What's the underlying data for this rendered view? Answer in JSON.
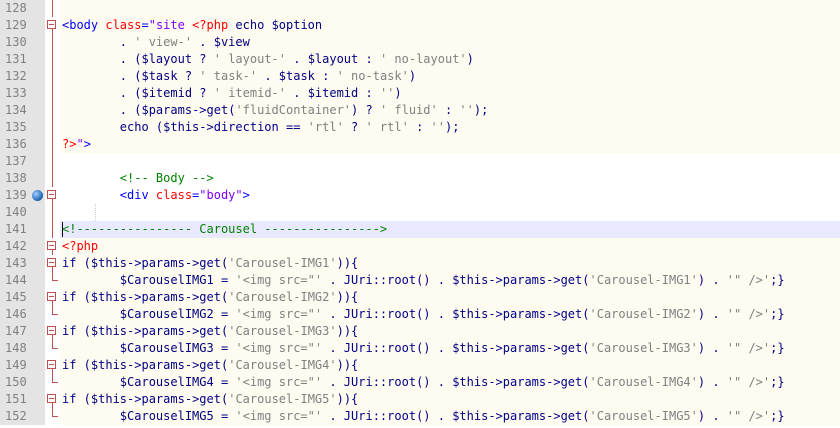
{
  "editor": {
    "lines": [
      {
        "num": "128",
        "fold": "line",
        "bg": "php",
        "tokens": []
      },
      {
        "num": "129",
        "fold": "box",
        "bg": "php",
        "tokens": [
          [
            "tag",
            "<body "
          ],
          [
            "attr",
            "class"
          ],
          [
            "tag",
            "="
          ],
          [
            "dq",
            "\"site "
          ],
          [
            "php",
            "<?php"
          ],
          [
            "kw",
            " echo "
          ],
          [
            "var",
            "$option"
          ]
        ]
      },
      {
        "num": "130",
        "fold": "line",
        "bg": "php",
        "tokens": [
          [
            "plain",
            "        "
          ],
          [
            "op",
            ". "
          ],
          [
            "str",
            "' view-'"
          ],
          [
            "op",
            " . "
          ],
          [
            "var",
            "$view"
          ]
        ]
      },
      {
        "num": "131",
        "fold": "line",
        "bg": "php",
        "tokens": [
          [
            "plain",
            "        "
          ],
          [
            "op",
            ". ("
          ],
          [
            "var",
            "$layout"
          ],
          [
            "op",
            " ? "
          ],
          [
            "str",
            "' layout-'"
          ],
          [
            "op",
            " . "
          ],
          [
            "var",
            "$layout"
          ],
          [
            "op",
            " : "
          ],
          [
            "str",
            "' no-layout'"
          ],
          [
            "op",
            ")"
          ]
        ]
      },
      {
        "num": "132",
        "fold": "line",
        "bg": "php",
        "tokens": [
          [
            "plain",
            "        "
          ],
          [
            "op",
            ". ("
          ],
          [
            "var",
            "$task"
          ],
          [
            "op",
            " ? "
          ],
          [
            "str",
            "' task-'"
          ],
          [
            "op",
            " . "
          ],
          [
            "var",
            "$task"
          ],
          [
            "op",
            " : "
          ],
          [
            "str",
            "' no-task'"
          ],
          [
            "op",
            ")"
          ]
        ]
      },
      {
        "num": "133",
        "fold": "line",
        "bg": "php",
        "tokens": [
          [
            "plain",
            "        "
          ],
          [
            "op",
            ". ("
          ],
          [
            "var",
            "$itemid"
          ],
          [
            "op",
            " ? "
          ],
          [
            "str",
            "' itemid-'"
          ],
          [
            "op",
            " . "
          ],
          [
            "var",
            "$itemid"
          ],
          [
            "op",
            " : "
          ],
          [
            "str",
            "''"
          ],
          [
            "op",
            ")"
          ]
        ]
      },
      {
        "num": "134",
        "fold": "line",
        "bg": "php",
        "tokens": [
          [
            "plain",
            "        "
          ],
          [
            "op",
            ". ("
          ],
          [
            "var",
            "$params"
          ],
          [
            "op",
            "->"
          ],
          [
            "kw",
            "get"
          ],
          [
            "op",
            "("
          ],
          [
            "str",
            "'fluidContainer'"
          ],
          [
            "op",
            ") ? "
          ],
          [
            "str",
            "' fluid'"
          ],
          [
            "op",
            " : "
          ],
          [
            "str",
            "''"
          ],
          [
            "op",
            ");"
          ]
        ]
      },
      {
        "num": "135",
        "fold": "line",
        "bg": "php",
        "tokens": [
          [
            "plain",
            "        "
          ],
          [
            "kw",
            "echo"
          ],
          [
            "op",
            " ("
          ],
          [
            "var",
            "$this"
          ],
          [
            "op",
            "->"
          ],
          [
            "kw",
            "direction"
          ],
          [
            "op",
            " == "
          ],
          [
            "str",
            "'rtl'"
          ],
          [
            "op",
            " ? "
          ],
          [
            "str",
            "' rtl'"
          ],
          [
            "op",
            " : "
          ],
          [
            "str",
            "''"
          ],
          [
            "op",
            ");"
          ]
        ]
      },
      {
        "num": "136",
        "fold": "line",
        "bg": "php",
        "tokens": [
          [
            "php",
            "?>"
          ],
          [
            "dq",
            "\""
          ],
          [
            "tag",
            ">"
          ]
        ]
      },
      {
        "num": "137",
        "fold": "line",
        "bg": "none",
        "tokens": []
      },
      {
        "num": "138",
        "fold": "line",
        "bg": "none",
        "tokens": [
          [
            "plain",
            "        "
          ],
          [
            "cmt",
            "<!-- Body -->"
          ]
        ]
      },
      {
        "num": "139",
        "fold": "box",
        "bg": "none",
        "marker": true,
        "tokens": [
          [
            "plain",
            "        "
          ],
          [
            "tag",
            "<div "
          ],
          [
            "attr",
            "class"
          ],
          [
            "tag",
            "="
          ],
          [
            "dq",
            "\"body\""
          ],
          [
            "tag",
            ">"
          ]
        ]
      },
      {
        "num": "140",
        "fold": "line",
        "bg": "none",
        "guide": true,
        "tokens": []
      },
      {
        "num": "141",
        "fold": "line",
        "bg": "sel",
        "caret": true,
        "tokens": [
          [
            "cmt",
            "<!---------------- Carousel ---------------->"
          ]
        ]
      },
      {
        "num": "142",
        "fold": "box",
        "bg": "php",
        "tokens": [
          [
            "php",
            "<?php"
          ]
        ]
      },
      {
        "num": "143",
        "fold": "box",
        "bg": "php",
        "tokens": [
          [
            "kw",
            "if"
          ],
          [
            "op",
            " ("
          ],
          [
            "var",
            "$this"
          ],
          [
            "op",
            "->"
          ],
          [
            "kw",
            "params"
          ],
          [
            "op",
            "->"
          ],
          [
            "kw",
            "get"
          ],
          [
            "op",
            "("
          ],
          [
            "str",
            "'Carousel-IMG1'"
          ],
          [
            "op",
            ")){"
          ]
        ]
      },
      {
        "num": "144",
        "fold": "end",
        "bg": "php",
        "tokens": [
          [
            "plain",
            "        "
          ],
          [
            "var",
            "$CarouselIMG1"
          ],
          [
            "op",
            " = "
          ],
          [
            "str",
            "'<img src=\"'"
          ],
          [
            "op",
            " . "
          ],
          [
            "kw",
            "JUri"
          ],
          [
            "op",
            "::"
          ],
          [
            "kw",
            "root"
          ],
          [
            "op",
            "() . "
          ],
          [
            "var",
            "$this"
          ],
          [
            "op",
            "->"
          ],
          [
            "kw",
            "params"
          ],
          [
            "op",
            "->"
          ],
          [
            "kw",
            "get"
          ],
          [
            "op",
            "("
          ],
          [
            "str",
            "'Carousel-IMG1'"
          ],
          [
            "op",
            ") . "
          ],
          [
            "str",
            "'\" />'"
          ],
          [
            "op",
            ";}"
          ]
        ]
      },
      {
        "num": "145",
        "fold": "box",
        "bg": "php",
        "tokens": [
          [
            "kw",
            "if"
          ],
          [
            "op",
            " ("
          ],
          [
            "var",
            "$this"
          ],
          [
            "op",
            "->"
          ],
          [
            "kw",
            "params"
          ],
          [
            "op",
            "->"
          ],
          [
            "kw",
            "get"
          ],
          [
            "op",
            "("
          ],
          [
            "str",
            "'Carousel-IMG2'"
          ],
          [
            "op",
            ")){"
          ]
        ]
      },
      {
        "num": "146",
        "fold": "end",
        "bg": "php",
        "tokens": [
          [
            "plain",
            "        "
          ],
          [
            "var",
            "$CarouselIMG2"
          ],
          [
            "op",
            " = "
          ],
          [
            "str",
            "'<img src=\"'"
          ],
          [
            "op",
            " . "
          ],
          [
            "kw",
            "JUri"
          ],
          [
            "op",
            "::"
          ],
          [
            "kw",
            "root"
          ],
          [
            "op",
            "() . "
          ],
          [
            "var",
            "$this"
          ],
          [
            "op",
            "->"
          ],
          [
            "kw",
            "params"
          ],
          [
            "op",
            "->"
          ],
          [
            "kw",
            "get"
          ],
          [
            "op",
            "("
          ],
          [
            "str",
            "'Carousel-IMG2'"
          ],
          [
            "op",
            ") . "
          ],
          [
            "str",
            "'\" />'"
          ],
          [
            "op",
            ";}"
          ]
        ]
      },
      {
        "num": "147",
        "fold": "box",
        "bg": "php",
        "tokens": [
          [
            "kw",
            "if"
          ],
          [
            "op",
            " ("
          ],
          [
            "var",
            "$this"
          ],
          [
            "op",
            "->"
          ],
          [
            "kw",
            "params"
          ],
          [
            "op",
            "->"
          ],
          [
            "kw",
            "get"
          ],
          [
            "op",
            "("
          ],
          [
            "str",
            "'Carousel-IMG3'"
          ],
          [
            "op",
            ")){"
          ]
        ]
      },
      {
        "num": "148",
        "fold": "end",
        "bg": "php",
        "tokens": [
          [
            "plain",
            "        "
          ],
          [
            "var",
            "$CarouselIMG3"
          ],
          [
            "op",
            " = "
          ],
          [
            "str",
            "'<img src=\"'"
          ],
          [
            "op",
            " . "
          ],
          [
            "kw",
            "JUri"
          ],
          [
            "op",
            "::"
          ],
          [
            "kw",
            "root"
          ],
          [
            "op",
            "() . "
          ],
          [
            "var",
            "$this"
          ],
          [
            "op",
            "->"
          ],
          [
            "kw",
            "params"
          ],
          [
            "op",
            "->"
          ],
          [
            "kw",
            "get"
          ],
          [
            "op",
            "("
          ],
          [
            "str",
            "'Carousel-IMG3'"
          ],
          [
            "op",
            ") . "
          ],
          [
            "str",
            "'\" />'"
          ],
          [
            "op",
            ";}"
          ]
        ]
      },
      {
        "num": "149",
        "fold": "box",
        "bg": "php",
        "tokens": [
          [
            "kw",
            "if"
          ],
          [
            "op",
            " ("
          ],
          [
            "var",
            "$this"
          ],
          [
            "op",
            "->"
          ],
          [
            "kw",
            "params"
          ],
          [
            "op",
            "->"
          ],
          [
            "kw",
            "get"
          ],
          [
            "op",
            "("
          ],
          [
            "str",
            "'Carousel-IMG4'"
          ],
          [
            "op",
            ")){"
          ]
        ]
      },
      {
        "num": "150",
        "fold": "end",
        "bg": "php",
        "tokens": [
          [
            "plain",
            "        "
          ],
          [
            "var",
            "$CarouselIMG4"
          ],
          [
            "op",
            " = "
          ],
          [
            "str",
            "'<img src=\"'"
          ],
          [
            "op",
            " . "
          ],
          [
            "kw",
            "JUri"
          ],
          [
            "op",
            "::"
          ],
          [
            "kw",
            "root"
          ],
          [
            "op",
            "() . "
          ],
          [
            "var",
            "$this"
          ],
          [
            "op",
            "->"
          ],
          [
            "kw",
            "params"
          ],
          [
            "op",
            "->"
          ],
          [
            "kw",
            "get"
          ],
          [
            "op",
            "("
          ],
          [
            "str",
            "'Carousel-IMG4'"
          ],
          [
            "op",
            ") . "
          ],
          [
            "str",
            "'\" />'"
          ],
          [
            "op",
            ";}"
          ]
        ]
      },
      {
        "num": "151",
        "fold": "box",
        "bg": "php",
        "tokens": [
          [
            "kw",
            "if"
          ],
          [
            "op",
            " ("
          ],
          [
            "var",
            "$this"
          ],
          [
            "op",
            "->"
          ],
          [
            "kw",
            "params"
          ],
          [
            "op",
            "->"
          ],
          [
            "kw",
            "get"
          ],
          [
            "op",
            "("
          ],
          [
            "str",
            "'Carousel-IMG5'"
          ],
          [
            "op",
            ")){"
          ]
        ]
      },
      {
        "num": "152",
        "fold": "end",
        "bg": "php",
        "tokens": [
          [
            "plain",
            "        "
          ],
          [
            "var",
            "$CarouselIMG5"
          ],
          [
            "op",
            " = "
          ],
          [
            "str",
            "'<img src=\"'"
          ],
          [
            "op",
            " . "
          ],
          [
            "kw",
            "JUri"
          ],
          [
            "op",
            "::"
          ],
          [
            "kw",
            "root"
          ],
          [
            "op",
            "() . "
          ],
          [
            "var",
            "$this"
          ],
          [
            "op",
            "->"
          ],
          [
            "kw",
            "params"
          ],
          [
            "op",
            "->"
          ],
          [
            "kw",
            "get"
          ],
          [
            "op",
            "("
          ],
          [
            "str",
            "'Carousel-IMG5'"
          ],
          [
            "op",
            ") . "
          ],
          [
            "str",
            "'\" />'"
          ],
          [
            "op",
            ";}"
          ]
        ]
      }
    ]
  }
}
